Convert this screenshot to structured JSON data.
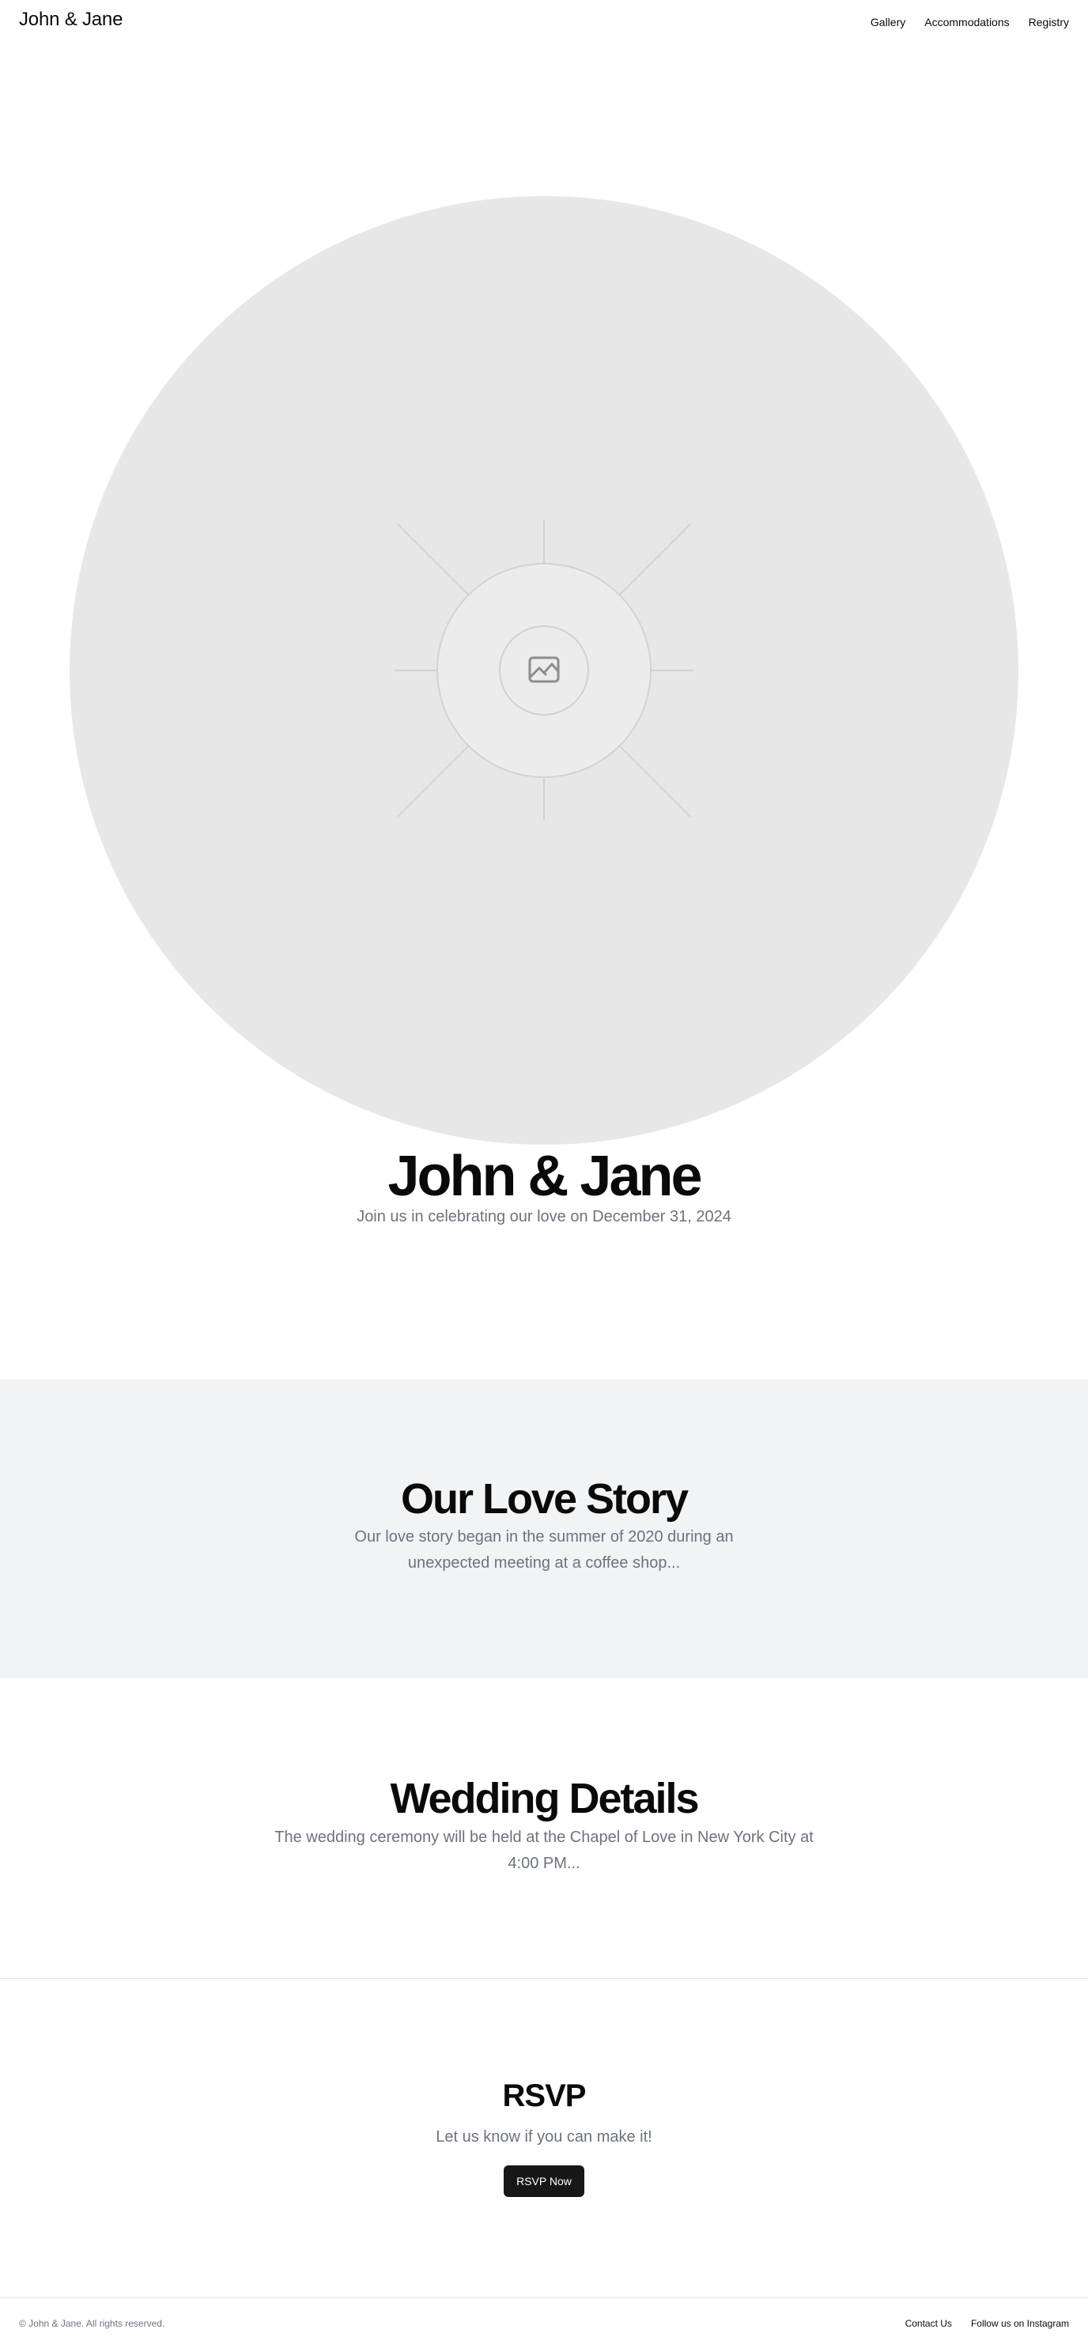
{
  "header": {
    "brand": "John & Jane",
    "nav": [
      "Gallery",
      "Accommodations",
      "Registry"
    ]
  },
  "hero": {
    "image_icon": "image-placeholder-icon",
    "title": "John & Jane",
    "subtitle": "Join us in celebrating our love on December 31, 2024"
  },
  "story": {
    "title": "Our Love Story",
    "text": "Our love story began in the summer of 2020 during an unexpected meeting at a coffee shop..."
  },
  "details": {
    "title": "Wedding Details",
    "text": "The wedding ceremony will be held at the Chapel of Love in New York City at 4:00 PM..."
  },
  "rsvp": {
    "title": "RSVP",
    "text": "Let us know if you can make it!",
    "button_label": "RSVP Now"
  },
  "footer": {
    "copyright": "© John & Jane. All rights reserved.",
    "links": [
      "Contact Us",
      "Follow us on Instagram"
    ]
  },
  "colors": {
    "text": "#0a0a0a",
    "muted": "#6b7280",
    "placeholder_bg": "#e7e7e7",
    "section_bg": "#f2f3f5",
    "button_bg": "#171717"
  }
}
